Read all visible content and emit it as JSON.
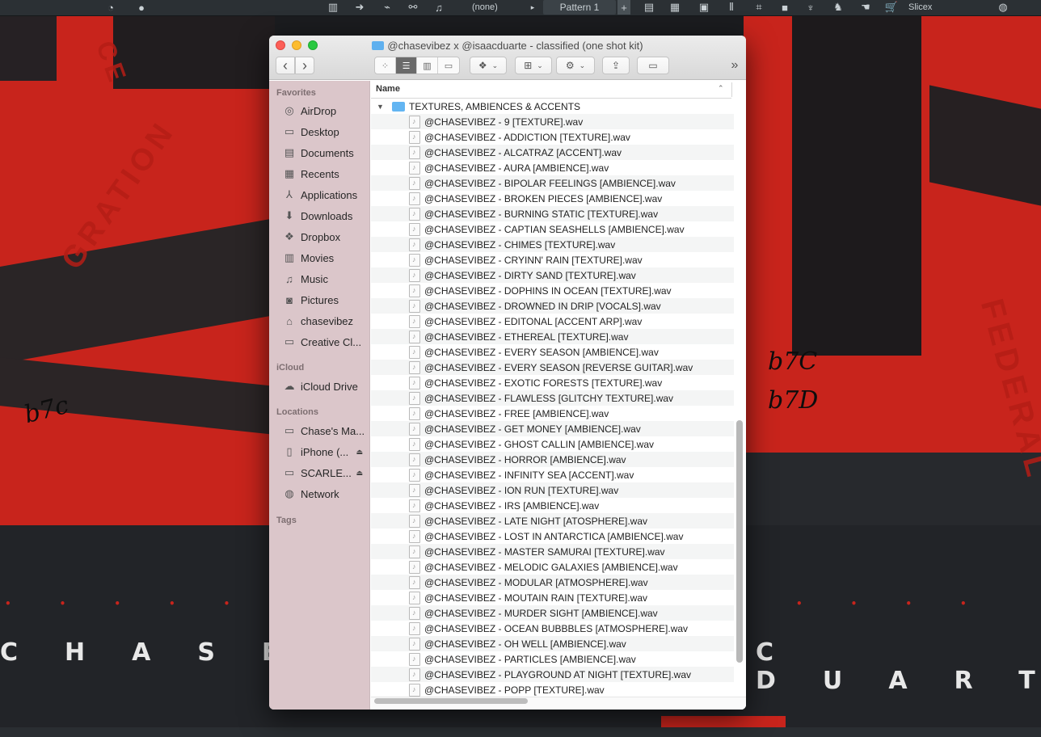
{
  "toolbar_top": {
    "pattern_selector": "(none)",
    "pattern_label": "Pattern 1",
    "plus_label": "+",
    "plugin_label": "Slicex"
  },
  "background_art": {
    "left_word": "CHASE V",
    "right_word": "C DUART",
    "scrawl_1": "b7c",
    "scrawl_2": "b7C",
    "scrawl_3": "b7D",
    "stamp_left": "GRATION",
    "stamp_right": "FEDERAL",
    "stamp_top": "CE"
  },
  "window": {
    "title": "@chasevibez x @isaacduarte - classified (one shot kit)",
    "nav_back": "‹",
    "nav_forward": "›",
    "more_label": "»",
    "column_name": "Name",
    "folder_name": "TEXTURES, AMBIENCES & ACCENTS",
    "files": [
      "@CHASEVIBEZ - 9 [TEXTURE].wav",
      "@CHASEVIBEZ - ADDICTION [TEXTURE].wav",
      "@CHASEVIBEZ - ALCATRAZ [ACCENT].wav",
      "@CHASEVIBEZ - AURA [AMBIENCE].wav",
      "@CHASEVIBEZ - BIPOLAR FEELINGS [AMBIENCE].wav",
      "@CHASEVIBEZ - BROKEN PIECES [AMBIENCE].wav",
      "@CHASEVIBEZ - BURNING STATIC [TEXTURE].wav",
      "@CHASEVIBEZ - CAPTIAN SEASHELLS [AMBIENCE].wav",
      "@CHASEVIBEZ - CHIMES [TEXTURE].wav",
      "@CHASEVIBEZ - CRYINN' RAIN [TEXTURE].wav",
      "@CHASEVIBEZ - DIRTY SAND [TEXTURE].wav",
      "@CHASEVIBEZ - DOPHINS IN OCEAN [TEXTURE].wav",
      "@CHASEVIBEZ - DROWNED IN DRIP [VOCALS].wav",
      "@CHASEVIBEZ - EDITONAL [ACCENT ARP].wav",
      "@CHASEVIBEZ - ETHEREAL [TEXTURE].wav",
      "@CHASEVIBEZ - EVERY SEASON [AMBIENCE].wav",
      "@CHASEVIBEZ - EVERY SEASON [REVERSE GUITAR].wav",
      "@CHASEVIBEZ - EXOTIC FORESTS [TEXTURE].wav",
      "@CHASEVIBEZ - FLAWLESS [GLITCHY TEXTURE].wav",
      "@CHASEVIBEZ - FREE [AMBIENCE].wav",
      "@CHASEVIBEZ - GET MONEY [AMBIENCE].wav",
      "@CHASEVIBEZ - GHOST CALLIN [AMBIENCE].wav",
      "@CHASEVIBEZ - HORROR [AMBIENCE].wav",
      "@CHASEVIBEZ - INFINITY SEA [ACCENT].wav",
      "@CHASEVIBEZ - ION RUN [TEXTURE].wav",
      "@CHASEVIBEZ - IRS [AMBIENCE].wav",
      "@CHASEVIBEZ - LATE NIGHT [ATOSPHERE].wav",
      "@CHASEVIBEZ - LOST IN ANTARCTICA [AMBIENCE].wav",
      "@CHASEVIBEZ - MASTER SAMURAI [TEXTURE].wav",
      "@CHASEVIBEZ - MELODIC GALAXIES [AMBIENCE].wav",
      "@CHASEVIBEZ - MODULAR [ATMOSPHERE].wav",
      "@CHASEVIBEZ - MOUTAIN RAIN [TEXTURE].wav",
      "@CHASEVIBEZ - MURDER SIGHT [AMBIENCE].wav",
      "@CHASEVIBEZ - OCEAN BUBBBLES [ATMOSPHERE].wav",
      "@CHASEVIBEZ - OH WELL [AMBIENCE].wav",
      "@CHASEVIBEZ - PARTICLES [AMBIENCE].wav",
      "@CHASEVIBEZ - PLAYGROUND AT NIGHT [TEXTURE].wav",
      "@CHASEVIBEZ - POPP [TEXTURE].wav"
    ]
  },
  "sidebar": {
    "favorites_heading": "Favorites",
    "favorites": [
      {
        "label": "AirDrop",
        "icon": "airdrop-icon"
      },
      {
        "label": "Desktop",
        "icon": "desktop-icon"
      },
      {
        "label": "Documents",
        "icon": "documents-icon"
      },
      {
        "label": "Recents",
        "icon": "recents-icon"
      },
      {
        "label": "Applications",
        "icon": "applications-icon"
      },
      {
        "label": "Downloads",
        "icon": "downloads-icon"
      },
      {
        "label": "Dropbox",
        "icon": "dropbox-icon"
      },
      {
        "label": "Movies",
        "icon": "movies-icon"
      },
      {
        "label": "Music",
        "icon": "music-icon"
      },
      {
        "label": "Pictures",
        "icon": "pictures-icon"
      },
      {
        "label": "chasevibez",
        "icon": "home-icon"
      },
      {
        "label": "Creative Cl...",
        "icon": "folder-icon"
      }
    ],
    "icloud_heading": "iCloud",
    "icloud": [
      {
        "label": "iCloud Drive",
        "icon": "icloud-icon"
      }
    ],
    "locations_heading": "Locations",
    "locations": [
      {
        "label": "Chase's Ma...",
        "icon": "laptop-icon",
        "eject": false
      },
      {
        "label": "iPhone (...",
        "icon": "iphone-icon",
        "eject": true
      },
      {
        "label": "SCARLE...",
        "icon": "drive-icon",
        "eject": true
      },
      {
        "label": "Network",
        "icon": "network-icon",
        "eject": false
      }
    ],
    "tags_heading": "Tags"
  }
}
